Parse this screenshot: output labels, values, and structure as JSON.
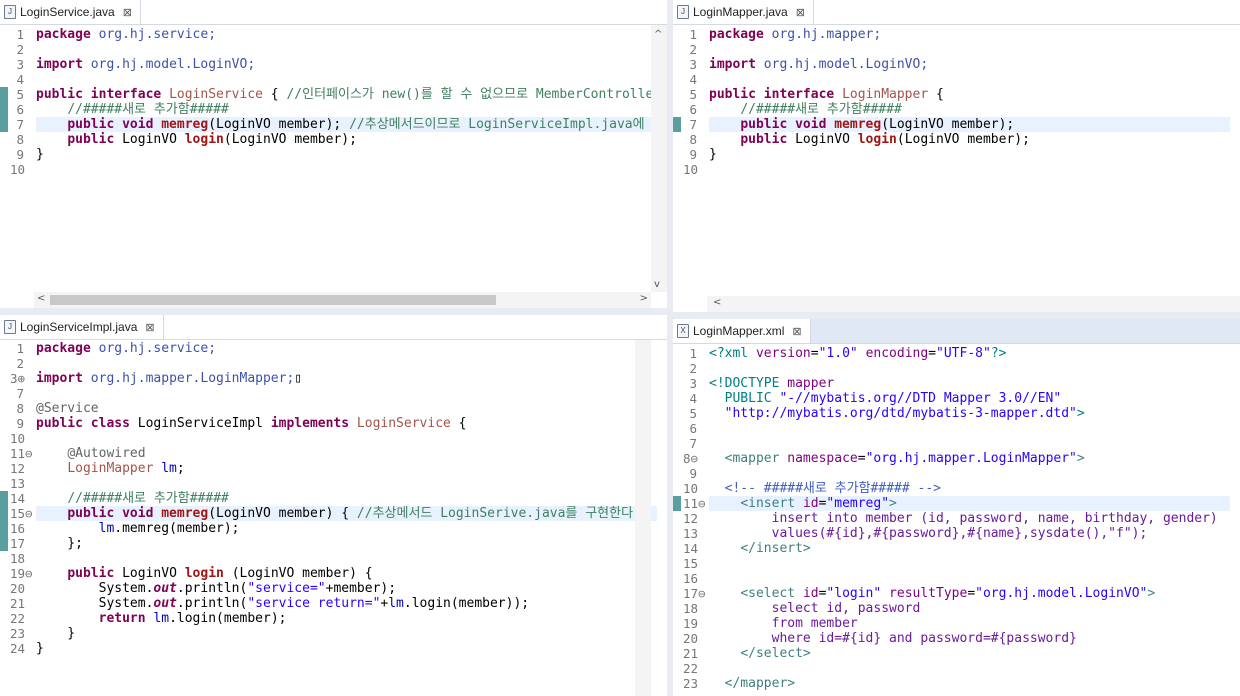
{
  "panes": {
    "service": {
      "tab": {
        "label": "LoginService.java",
        "icon": "java-file-icon",
        "close": "⊠"
      },
      "lines": [
        {
          "n": "1",
          "html": "<span class=\"kw\">package</span> <span class=\"pk\">org.hj.service;</span>"
        },
        {
          "n": "2",
          "html": ""
        },
        {
          "n": "3",
          "html": "<span class=\"kw\">import</span> <span class=\"pk\">org.hj.model.LoginVO;</span>"
        },
        {
          "n": "4",
          "html": ""
        },
        {
          "n": "5",
          "html": "<span class=\"kw\">public interface</span> <span class=\"ty\">LoginService</span> { <span class=\"cm\">//인터페이스가 new()를 할 수 없으므로 MemberController.</span>"
        },
        {
          "n": "6",
          "html": "    <span class=\"cm\">//#####새로 추가함#####</span>"
        },
        {
          "n": "7",
          "html": "    <span class=\"kw\">public void</span> <span class=\"mt\">memreg</span>(LoginVO member); <span class=\"cm\">//추상메서드이므로 LoginServiceImpl.java에</span>"
        },
        {
          "n": "8",
          "html": "    <span class=\"kw\">public</span> LoginVO <span class=\"mt\">login</span>(LoginVO member);"
        },
        {
          "n": "9",
          "html": "}"
        },
        {
          "n": "10",
          "html": ""
        }
      ]
    },
    "mapper": {
      "tab": {
        "label": "LoginMapper.java",
        "icon": "java-file-icon",
        "close": "⊠"
      },
      "lines": [
        {
          "n": "1",
          "html": "<span class=\"kw\">package</span> <span class=\"pk\">org.hj.mapper;</span>"
        },
        {
          "n": "2",
          "html": ""
        },
        {
          "n": "3",
          "html": "<span class=\"kw\">import</span> <span class=\"pk\">org.hj.model.LoginVO;</span>"
        },
        {
          "n": "4",
          "html": ""
        },
        {
          "n": "5",
          "html": "<span class=\"kw\">public interface</span> <span class=\"ty\">LoginMapper</span> {"
        },
        {
          "n": "6",
          "html": "    <span class=\"cm\">//#####새로 추가함#####</span>"
        },
        {
          "n": "7",
          "html": "    <span class=\"kw\">public void</span> <span class=\"mt\">memreg</span>(LoginVO member);"
        },
        {
          "n": "8",
          "html": "    <span class=\"kw\">public</span> LoginVO <span class=\"mt\">login</span>(LoginVO member);"
        },
        {
          "n": "9",
          "html": "}"
        },
        {
          "n": "10",
          "html": ""
        }
      ]
    },
    "impl": {
      "tab": {
        "label": "LoginServiceImpl.java",
        "icon": "java-file-icon",
        "close": "⊠"
      },
      "lines": [
        {
          "n": "1",
          "html": "<span class=\"kw\">package</span> <span class=\"pk\">org.hj.service;</span>"
        },
        {
          "n": "2",
          "html": ""
        },
        {
          "n": "3⊕",
          "html": "<span class=\"kw\">import</span> <span class=\"pk\">org.hj.mapper.LoginMapper;</span>▯"
        },
        {
          "n": "7",
          "html": ""
        },
        {
          "n": "8",
          "html": "<span class=\"an\">@Service</span>"
        },
        {
          "n": "9",
          "html": "<span class=\"kw\">public class</span> LoginServiceImpl <span class=\"kw\">implements</span> <span class=\"ty\">LoginService</span> {"
        },
        {
          "n": "10",
          "html": ""
        },
        {
          "n": "11⊖",
          "html": "    <span class=\"an\">@Autowired</span>"
        },
        {
          "n": "12",
          "html": "    <span class=\"ty\">LoginMapper</span> <span class=\"fl\">lm</span>;"
        },
        {
          "n": "13",
          "html": ""
        },
        {
          "n": "14",
          "html": "    <span class=\"cm\">//#####새로 추가함#####</span>"
        },
        {
          "n": "15⊖",
          "html": "    <span class=\"kw\">public void</span> <span class=\"mt\">memreg</span>(LoginVO member) { <span class=\"cm\">//추상메서드 LoginSerive.java를 구현한다.</span>"
        },
        {
          "n": "16",
          "html": "        <span class=\"fl\">lm</span>.memreg(member);"
        },
        {
          "n": "17",
          "html": "    };"
        },
        {
          "n": "18",
          "html": ""
        },
        {
          "n": "19⊖",
          "html": "    <span class=\"kw\">public</span> LoginVO <span class=\"mt\">login</span> (LoginVO member) {"
        },
        {
          "n": "20",
          "html": "        System.<span class=\"it\">out</span>.println(<span class=\"st\">\"service=\"</span>+member);"
        },
        {
          "n": "21",
          "html": "        System.<span class=\"it\">out</span>.println(<span class=\"st\">\"service return=\"</span>+<span class=\"fl\">lm</span>.login(member));"
        },
        {
          "n": "22",
          "html": "        <span class=\"kw\">return</span> <span class=\"fl\">lm</span>.login(member);"
        },
        {
          "n": "23",
          "html": "    }"
        },
        {
          "n": "24",
          "html": "}"
        }
      ]
    },
    "xml": {
      "tab": {
        "label": "LoginMapper.xml",
        "icon": "xml-file-icon",
        "close": "⊠"
      },
      "lines": [
        {
          "n": "1",
          "html": "<span class=\"xd\">&lt;?xml</span> <span class=\"xa\">version</span>=<span class=\"xv\">\"1.0\"</span> <span class=\"xa\">encoding</span>=<span class=\"xv\">\"UTF-8\"</span><span class=\"xd\">?&gt;</span>"
        },
        {
          "n": "2",
          "html": ""
        },
        {
          "n": "3",
          "html": "<span class=\"xd\">&lt;!DOCTYPE</span> <span class=\"xa\">mapper</span>"
        },
        {
          "n": "4",
          "html": "  <span class=\"xd\">PUBLIC</span> <span class=\"xv\">\"-//mybatis.org//DTD Mapper 3.0//EN\"</span>"
        },
        {
          "n": "5",
          "html": "  <span class=\"xv\">\"http://mybatis.org/dtd/mybatis-3-mapper.dtd\"</span><span class=\"xd\">&gt;</span>"
        },
        {
          "n": "6",
          "html": ""
        },
        {
          "n": "7",
          "html": ""
        },
        {
          "n": "8⊖",
          "html": "  <span class=\"xt\">&lt;mapper</span> <span class=\"xa\">namespace</span>=<span class=\"xv\">\"org.hj.mapper.LoginMapper\"</span><span class=\"xt\">&gt;</span>"
        },
        {
          "n": "9",
          "html": ""
        },
        {
          "n": "10",
          "html": "  <span class=\"xc\">&lt;!-- #####새로 추가함##### --&gt;</span>"
        },
        {
          "n": "11⊖",
          "html": "    <span class=\"xt\">&lt;insert</span> <span class=\"xa\">id</span>=<span class=\"xv\">\"memreg\"</span><span class=\"xt\">&gt;</span>"
        },
        {
          "n": "12",
          "html": "        <span class=\"sql\">insert into member (id, password, name, birthday, gender)</span>"
        },
        {
          "n": "13",
          "html": "        <span class=\"sql\">values(#{id},#{password},#{name},sysdate(),\"f\");</span>"
        },
        {
          "n": "14",
          "html": "    <span class=\"xt\">&lt;/insert&gt;</span>"
        },
        {
          "n": "15",
          "html": ""
        },
        {
          "n": "16",
          "html": ""
        },
        {
          "n": "17⊖",
          "html": "    <span class=\"xt\">&lt;select</span> <span class=\"xa\">id</span>=<span class=\"xv\">\"login\"</span> <span class=\"xa\">resultType</span>=<span class=\"xv\">\"org.hj.model.LoginVO\"</span><span class=\"xt\">&gt;</span>"
        },
        {
          "n": "18",
          "html": "        <span class=\"sql\">select id, password</span>"
        },
        {
          "n": "19",
          "html": "        <span class=\"sql\">from member</span>"
        },
        {
          "n": "20",
          "html": "        <span class=\"sql\">where id=#{id} and password=#{password}</span>"
        },
        {
          "n": "21",
          "html": "    <span class=\"xt\">&lt;/select&gt;</span>"
        },
        {
          "n": "22",
          "html": ""
        },
        {
          "n": "23",
          "html": "  <span class=\"xt\">&lt;/mapper&gt;</span>"
        }
      ]
    }
  }
}
